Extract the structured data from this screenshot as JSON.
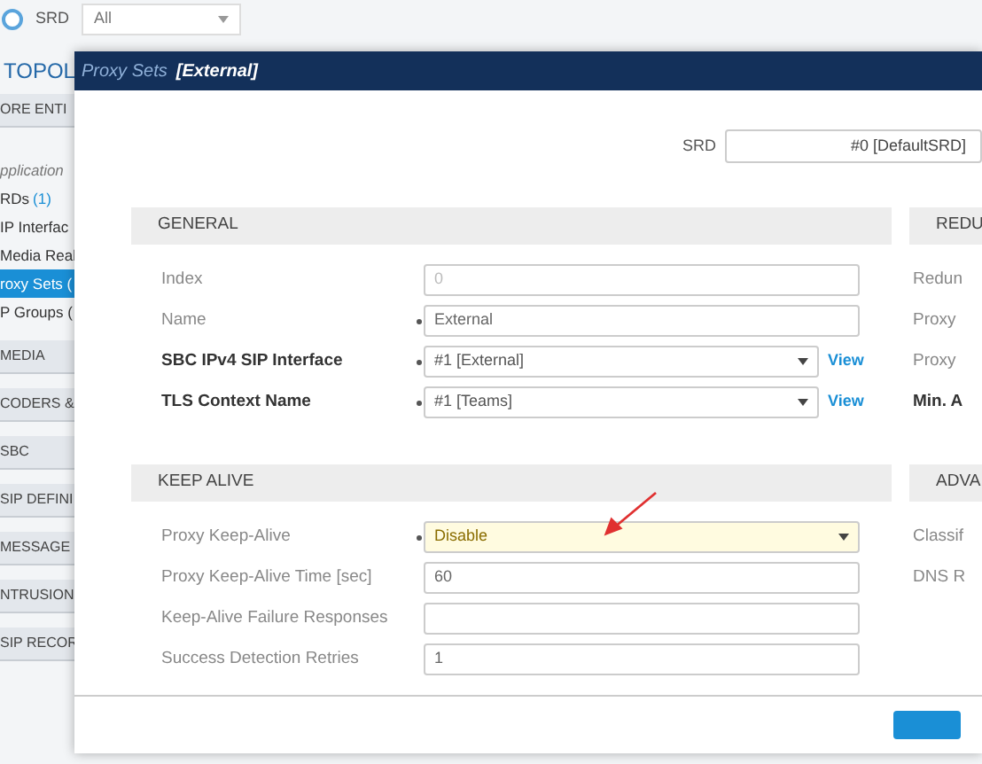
{
  "top_bar": {
    "srd_label": "SRD",
    "srd_value": "All"
  },
  "sidebar": {
    "title": "TOPOL",
    "items": [
      {
        "kind": "section",
        "label": "ORE ENTI",
        "selected": false
      },
      {
        "kind": "subheading",
        "label": "pplication",
        "selected": false
      },
      {
        "kind": "link",
        "label": "RDs",
        "count": "(1)",
        "selected": false
      },
      {
        "kind": "link",
        "label": "IP Interfac",
        "selected": false
      },
      {
        "kind": "link",
        "label": "Media Real",
        "selected": false
      },
      {
        "kind": "link",
        "label": "roxy Sets (",
        "selected": true
      },
      {
        "kind": "link",
        "label": "P Groups (",
        "selected": false
      },
      {
        "kind": "section",
        "label": "MEDIA",
        "selected": false
      },
      {
        "kind": "section",
        "label": "CODERS &",
        "selected": false
      },
      {
        "kind": "section",
        "label": "SBC",
        "selected": false
      },
      {
        "kind": "section",
        "label": "SIP DEFINI",
        "selected": false
      },
      {
        "kind": "section",
        "label": "MESSAGE",
        "selected": false
      },
      {
        "kind": "section",
        "label": "NTRUSION",
        "selected": false
      },
      {
        "kind": "section",
        "label": "SIP RECOR",
        "selected": false
      }
    ]
  },
  "dialog": {
    "title": "Proxy Sets",
    "subtitle": "[External]",
    "srd_label": "SRD",
    "srd_value": "#0 [DefaultSRD]",
    "left_panels": [
      {
        "title": "GENERAL",
        "rows": [
          {
            "label": "Index",
            "kind": "disabled",
            "value": "0",
            "required": false,
            "bold": false
          },
          {
            "label": "Name",
            "kind": "text",
            "value": "External",
            "required": true,
            "bold": false
          },
          {
            "label": "SBC IPv4 SIP Interface",
            "kind": "select",
            "value": "#1 [External]",
            "required": true,
            "bold": true,
            "highlighted": false,
            "link": "View"
          },
          {
            "label": "TLS Context Name",
            "kind": "select",
            "value": "#1 [Teams]",
            "required": true,
            "bold": true,
            "highlighted": false,
            "link": "View"
          }
        ]
      },
      {
        "title": "KEEP ALIVE",
        "rows": [
          {
            "label": "Proxy Keep-Alive",
            "kind": "select",
            "value": "Disable",
            "required": true,
            "bold": false,
            "highlighted": true
          },
          {
            "label": "Proxy Keep-Alive Time [sec]",
            "kind": "text",
            "value": "60",
            "required": false,
            "bold": false
          },
          {
            "label": "Keep-Alive Failure Responses",
            "kind": "text",
            "required": false,
            "bold": false
          },
          {
            "label": "Success Detection Retries",
            "kind": "text",
            "value": "1",
            "required": false,
            "bold": false
          }
        ]
      }
    ],
    "right_panels": [
      {
        "title": "REDU",
        "rows": [
          {
            "label": "Redun",
            "bold": false
          },
          {
            "label": "Proxy",
            "bold": false
          },
          {
            "label": "Proxy",
            "bold": false
          },
          {
            "label": "Min. A",
            "bold": true
          }
        ]
      },
      {
        "title": "ADVA",
        "rows": [
          {
            "label": "Classif",
            "bold": false
          },
          {
            "label": "DNS R",
            "bold": false
          }
        ]
      }
    ]
  }
}
